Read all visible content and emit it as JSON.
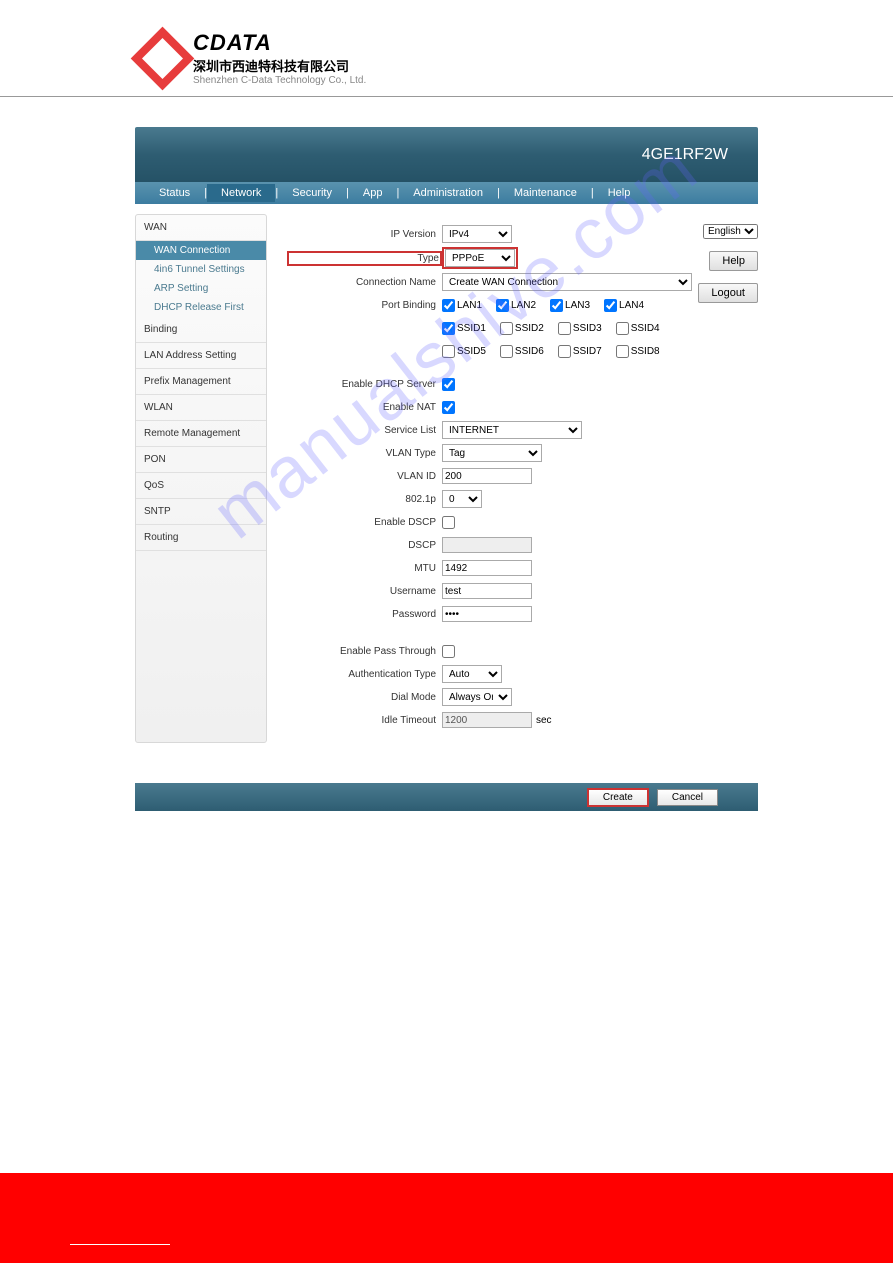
{
  "logo": {
    "brand": "CDATA",
    "chinese": "深圳市西迪特科技有限公司",
    "english": "Shenzhen C-Data Technology Co., Ltd."
  },
  "device_title": "4GE1RF2W",
  "menu": {
    "items": [
      "Status",
      "Network",
      "Security",
      "App",
      "Administration",
      "Maintenance",
      "Help"
    ],
    "active_index": 1
  },
  "sidebar": {
    "sections": [
      {
        "label": "WAN",
        "expanded": true,
        "subs": [
          "WAN Connection",
          "4in6 Tunnel Settings",
          "ARP Setting",
          "DHCP Release First"
        ],
        "active_sub": 0
      },
      {
        "label": "Binding"
      },
      {
        "label": "LAN Address Setting"
      },
      {
        "label": "Prefix Management"
      },
      {
        "label": "WLAN"
      },
      {
        "label": "Remote Management"
      },
      {
        "label": "PON"
      },
      {
        "label": "QoS"
      },
      {
        "label": "SNTP"
      },
      {
        "label": "Routing"
      }
    ]
  },
  "side_actions": {
    "lang": "English",
    "help": "Help",
    "logout": "Logout"
  },
  "form": {
    "ip_version": {
      "label": "IP Version",
      "value": "IPv4"
    },
    "type": {
      "label": "Type",
      "value": "PPPoE"
    },
    "conn_name": {
      "label": "Connection Name",
      "value": "Create WAN Connection"
    },
    "port_binding": {
      "label": "Port Binding",
      "row1": [
        {
          "name": "LAN1",
          "checked": true
        },
        {
          "name": "LAN2",
          "checked": true
        },
        {
          "name": "LAN3",
          "checked": true
        },
        {
          "name": "LAN4",
          "checked": true
        }
      ],
      "row2": [
        {
          "name": "SSID1",
          "checked": true
        },
        {
          "name": "SSID2",
          "checked": false
        },
        {
          "name": "SSID3",
          "checked": false
        },
        {
          "name": "SSID4",
          "checked": false
        }
      ],
      "row3": [
        {
          "name": "SSID5",
          "checked": false
        },
        {
          "name": "SSID6",
          "checked": false
        },
        {
          "name": "SSID7",
          "checked": false
        },
        {
          "name": "SSID8",
          "checked": false
        }
      ]
    },
    "enable_dhcp": {
      "label": "Enable DHCP Server",
      "checked": true
    },
    "enable_nat": {
      "label": "Enable NAT",
      "checked": true
    },
    "service_list": {
      "label": "Service List",
      "value": "INTERNET"
    },
    "vlan_type": {
      "label": "VLAN Type",
      "value": "Tag"
    },
    "vlan_id": {
      "label": "VLAN ID",
      "value": "200"
    },
    "p8021p": {
      "label": "802.1p",
      "value": "0"
    },
    "enable_dscp": {
      "label": "Enable DSCP",
      "checked": false
    },
    "dscp": {
      "label": "DSCP",
      "value": ""
    },
    "mtu": {
      "label": "MTU",
      "value": "1492"
    },
    "username": {
      "label": "Username",
      "value": "test"
    },
    "password": {
      "label": "Password",
      "value": "••••"
    },
    "pass_through": {
      "label": "Enable Pass Through",
      "checked": false
    },
    "auth_type": {
      "label": "Authentication Type",
      "value": "Auto"
    },
    "dial_mode": {
      "label": "Dial Mode",
      "value": "Always Or"
    },
    "idle_timeout": {
      "label": "Idle Timeout",
      "value": "1200",
      "unit": "sec"
    }
  },
  "footer": {
    "create": "Create",
    "cancel": "Cancel"
  },
  "watermark": "manualshive.com"
}
